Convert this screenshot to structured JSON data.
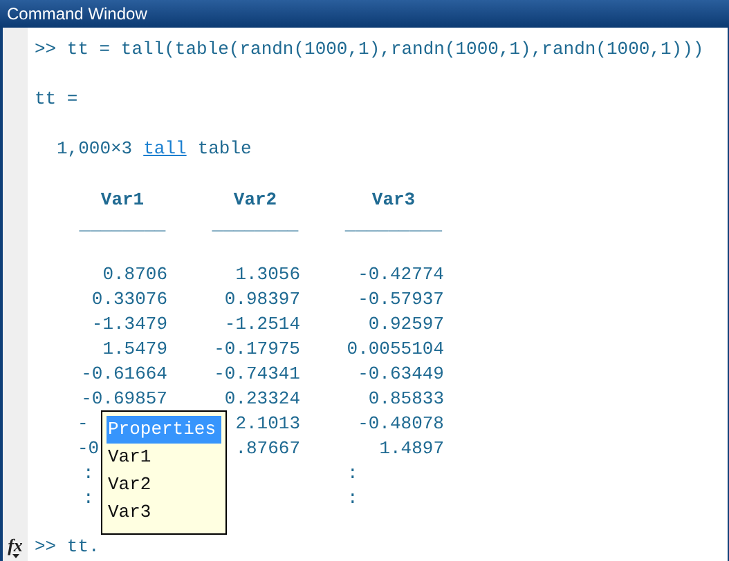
{
  "window": {
    "title": "Command Window"
  },
  "output": {
    "command_line": ">> tt = tall(table(randn(1000,1),randn(1000,1),randn(1000,1)))",
    "variable_line": "tt =",
    "size_text": "1,000×3",
    "class_link": "tall",
    "class_suffix": "table"
  },
  "table": {
    "columns": [
      {
        "name": "Var1",
        "underline": "________"
      },
      {
        "name": "Var2",
        "underline": "________"
      },
      {
        "name": "Var3",
        "underline": "_________"
      }
    ],
    "rows": [
      {
        "kind": "data",
        "cells": [
          {
            "text": "0.8706",
            "clipped": false
          },
          {
            "text": "1.3056",
            "clipped": false
          },
          {
            "text": "-0.42774",
            "clipped": false
          }
        ]
      },
      {
        "kind": "data",
        "cells": [
          {
            "text": "0.33076",
            "clipped": false
          },
          {
            "text": "0.98397",
            "clipped": false
          },
          {
            "text": "-0.57937",
            "clipped": false
          }
        ]
      },
      {
        "kind": "data",
        "cells": [
          {
            "text": "-1.3479",
            "clipped": false
          },
          {
            "text": "-1.2514",
            "clipped": false
          },
          {
            "text": "0.92597",
            "clipped": false
          }
        ]
      },
      {
        "kind": "data",
        "cells": [
          {
            "text": "1.5479",
            "clipped": false
          },
          {
            "text": "-0.17975",
            "clipped": false
          },
          {
            "text": "0.0055104",
            "clipped": false
          }
        ]
      },
      {
        "kind": "data",
        "cells": [
          {
            "text": "-0.61664",
            "clipped": false
          },
          {
            "text": "-0.74341",
            "clipped": false
          },
          {
            "text": "-0.63449",
            "clipped": false
          }
        ]
      },
      {
        "kind": "data",
        "cells": [
          {
            "text": "-0.69857",
            "clipped": false
          },
          {
            "text": "0.23324",
            "clipped": false
          },
          {
            "text": "0.85833",
            "clipped": false
          }
        ]
      },
      {
        "kind": "data",
        "cells": [
          {
            "text": "-",
            "clipped": true
          },
          {
            "text": "2.1013",
            "clipped": false
          },
          {
            "text": "-0.48078",
            "clipped": false
          }
        ]
      },
      {
        "kind": "data",
        "cells": [
          {
            "text": "-0",
            "clipped": true
          },
          {
            "text": ".87667",
            "clipped": false
          },
          {
            "text": "1.4897",
            "clipped": false
          }
        ]
      },
      {
        "kind": "more",
        "left": ":",
        "right": ":"
      },
      {
        "kind": "more",
        "left": ":",
        "right": ":"
      }
    ]
  },
  "completion_popup": {
    "items": [
      {
        "label": "Properties",
        "selected": true
      },
      {
        "label": "Var1",
        "selected": false
      },
      {
        "label": "Var2",
        "selected": false
      },
      {
        "label": "Var3",
        "selected": false
      }
    ]
  },
  "prompt": {
    "function_button": "fx",
    "text": ">> tt."
  }
}
